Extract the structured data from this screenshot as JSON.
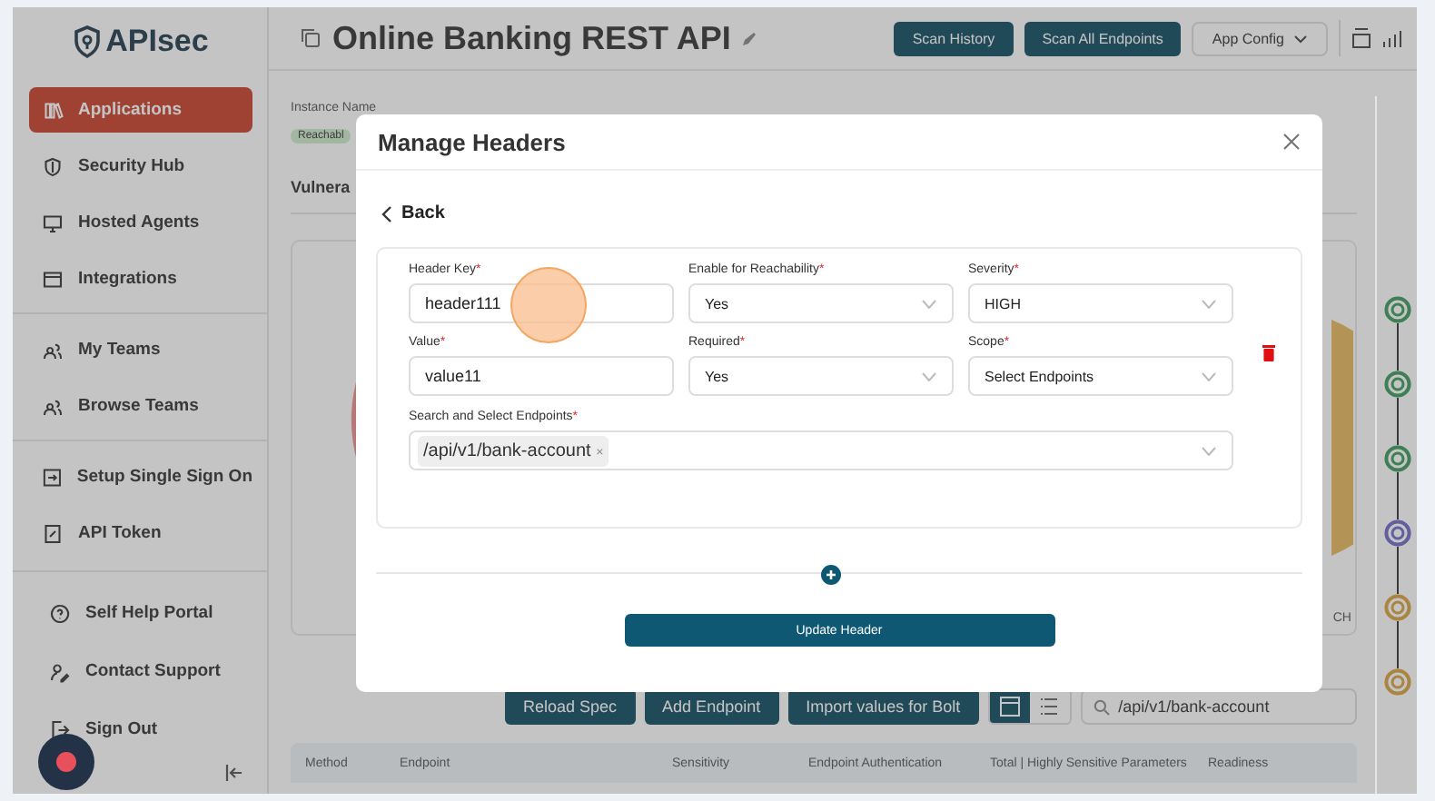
{
  "sidebar": {
    "logo": "APIsec",
    "items": [
      {
        "label": "Applications",
        "selected": true
      },
      {
        "label": "Security Hub",
        "selected": false
      },
      {
        "label": "Hosted Agents",
        "selected": false
      },
      {
        "label": "Integrations",
        "selected": false
      },
      {
        "label": "My Teams",
        "selected": false
      },
      {
        "label": "Browse Teams",
        "selected": false
      },
      {
        "label": "Setup Single Sign On",
        "selected": false
      },
      {
        "label": "API Token",
        "selected": false
      }
    ],
    "footer_items": [
      "Self Help Portal",
      "Contact Support",
      "Sign Out"
    ]
  },
  "header": {
    "title": "Online Banking REST API",
    "buttons": [
      "Scan History",
      "Scan All Endpoints"
    ],
    "dropdown": "App Config"
  },
  "background": {
    "instance": "Instance Name",
    "badge": "Reachabl",
    "tab": "Vulnera",
    "chart_fragment": "CH",
    "rail": [
      {
        "color": "#3e7f55"
      },
      {
        "color": "#3e7f55"
      },
      {
        "color": "#3e7f55"
      },
      {
        "color": "#635e9f"
      },
      {
        "color": "#aa8541"
      },
      {
        "color": "#aa8541"
      }
    ]
  },
  "toolbar": {
    "buttons": [
      "Reload Spec",
      "Add Endpoint",
      "Import values for Bolt"
    ],
    "search": "/api/v1/bank-account"
  },
  "table": {
    "columns": [
      "Method",
      "Endpoint",
      "Sensitivity",
      "Endpoint Authentication",
      "Total | Highly Sensitive Parameters",
      "Readiness"
    ]
  },
  "modal": {
    "title": "Manage Headers",
    "back": "Back",
    "fields": [
      {
        "label": "Header Key",
        "mark": "*",
        "kind": "input",
        "value": "header111"
      },
      {
        "label": "Enable for Reachability",
        "mark": "*",
        "kind": "select",
        "value": "Yes"
      },
      {
        "label": "Severity",
        "mark": "*",
        "kind": "select",
        "value": "HIGH"
      },
      {
        "label": "Value",
        "mark": "*",
        "kind": "input",
        "value": "value11"
      },
      {
        "label": "Required",
        "mark": "*",
        "kind": "select",
        "value": "Yes"
      },
      {
        "label": "Scope",
        "mark": "*",
        "kind": "select",
        "value": "Select Endpoints"
      }
    ],
    "endpoints": {
      "label": "Search and Select Endpoints",
      "mark": "*",
      "tags": [
        {
          "text": "/api/v1/bank-account",
          "remove": "×"
        }
      ]
    },
    "submit": "Update Header"
  }
}
